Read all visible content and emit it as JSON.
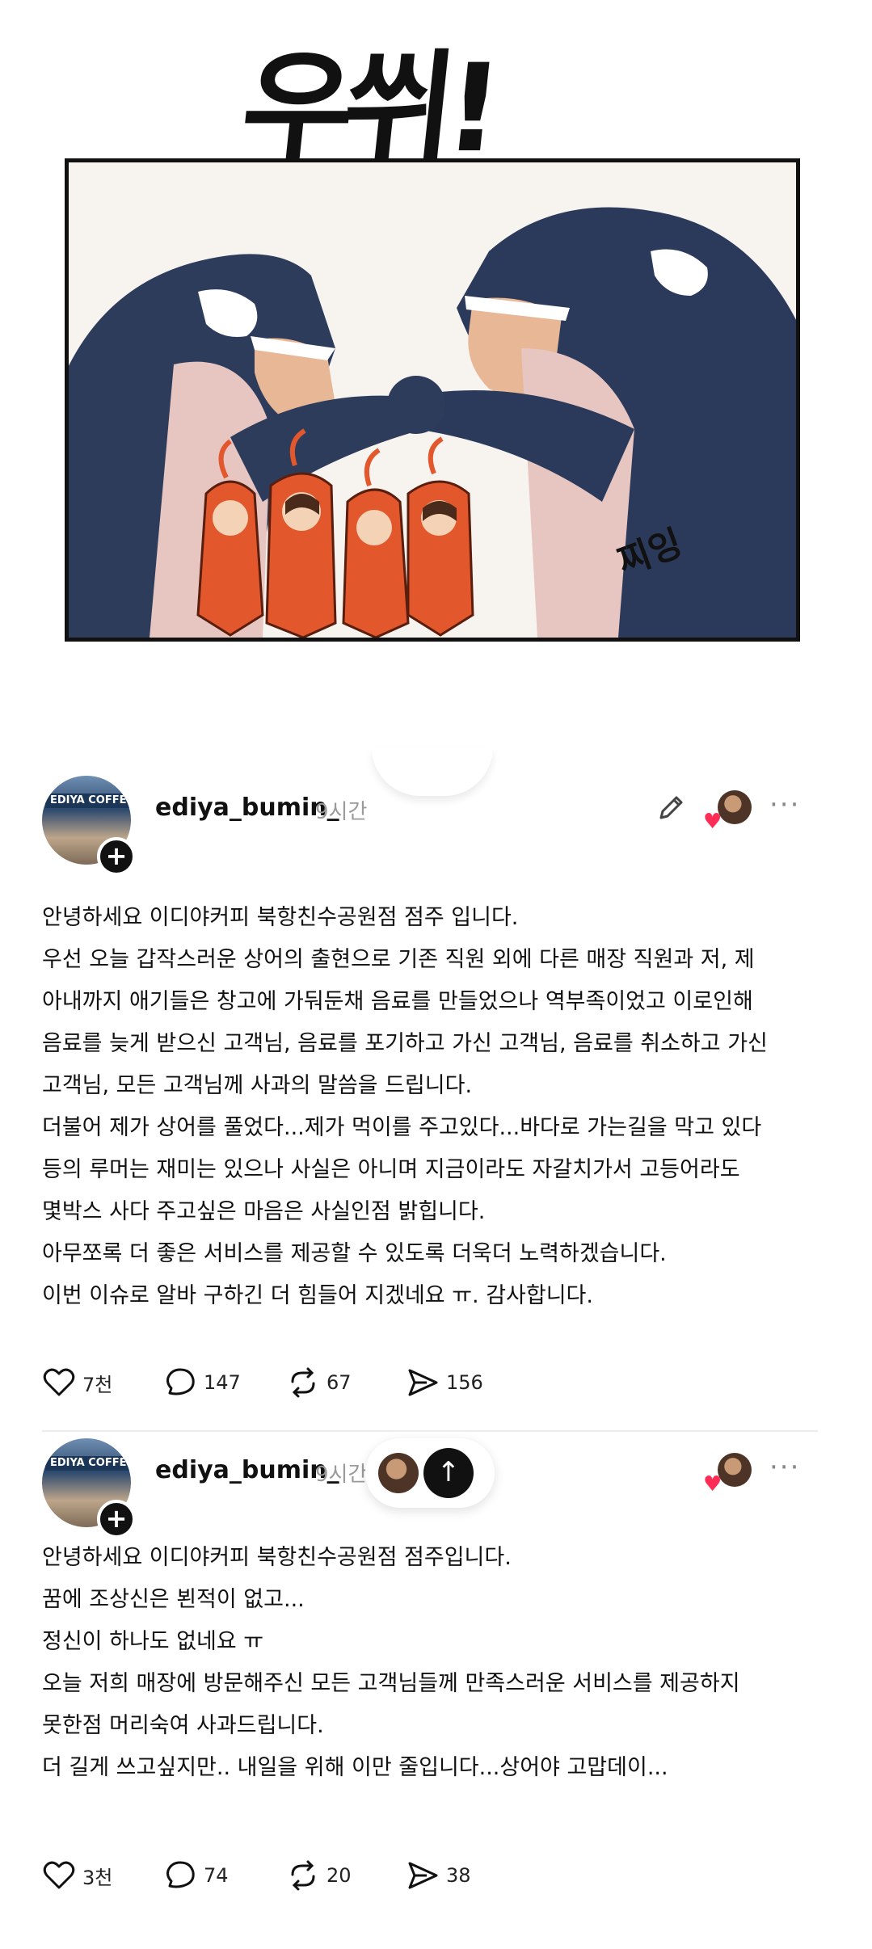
{
  "comic": {
    "sfx_main": "우쒸!",
    "sfx_small": "찌잉"
  },
  "posts": [
    {
      "avatar_sign": "EDIYA COFFEE",
      "username": "ediya_bumin_",
      "time": "9시간",
      "lines": [
        "안녕하세요 이디야커피 북항친수공원점 점주 입니다.",
        "우선 오늘 갑작스러운 상어의 출현으로 기존 직원 외에 다른 매장 직원과 저, 제",
        "아내까지 애기들은 창고에 가둬둔채 음료를 만들었으나 역부족이었고 이로인해",
        "음료를 늦게 받으신 고객님, 음료를 포기하고 가신 고객님, 음료를 취소하고 가신",
        "고객님, 모든 고객님께 사과의 말씀을 드립니다.",
        "더불어 제가 상어를 풀었다...제가 먹이를 주고있다...바다로 가는길을 막고 있다",
        "등의 루머는 재미는 있으나 사실은 아니며 지금이라도 자갈치가서 고등어라도",
        "몇박스 사다 주고싶은 마음은 사실인점 밝힙니다.",
        "아무쪼록 더 좋은 서비스를 제공할 수 있도록 더욱더 노력하겠습니다.",
        "이번 이슈로 알바 구하긴 더 힘들어 지겠네요 ㅠ. 감사합니다."
      ],
      "likes": "7천",
      "comments": "147",
      "reposts": "67",
      "shares": "156"
    },
    {
      "avatar_sign": "EDIYA COFFEE",
      "username": "ediya_bumin_",
      "time": "9시간",
      "lines": [
        "안녕하세요 이디야커피 북항친수공원점 점주입니다.",
        "꿈에 조상신은 뵌적이 없고...",
        "정신이 하나도 없네요 ㅠ",
        "오늘 저희 매장에 방문해주신 모든 고객님들께 만족스러운 서비스를 제공하지",
        "못한점 머리숙여 사과드립니다.",
        "더 길게 쓰고싶지만.. 내일을 위해 이만 줄입니다...상어야 고맙데이..."
      ],
      "likes": "3천",
      "comments": "74",
      "reposts": "20",
      "shares": "38"
    }
  ],
  "colors": {
    "like_heart": "#ff2d55",
    "divider": "#ececec",
    "timestamp": "#9a9a9a"
  },
  "icons": [
    "edit-icon",
    "heart-icon",
    "comment-icon",
    "repost-icon",
    "share-icon",
    "more-icon",
    "plus-icon",
    "arrow-up-icon"
  ]
}
